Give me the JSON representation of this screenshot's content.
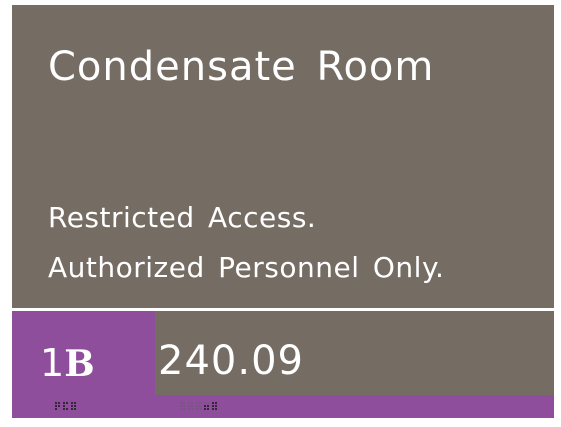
{
  "sign": {
    "room_name": "Condensate Room",
    "notice_line_1": "Restricted Access.",
    "notice_line_2": "Authorized Personnel Only.",
    "level_number": "1",
    "level_letter": "B",
    "room_number": "240.09"
  },
  "colors": {
    "panel": "#756c64",
    "accent": "#8e4e9b",
    "text": "#ffffff"
  }
}
